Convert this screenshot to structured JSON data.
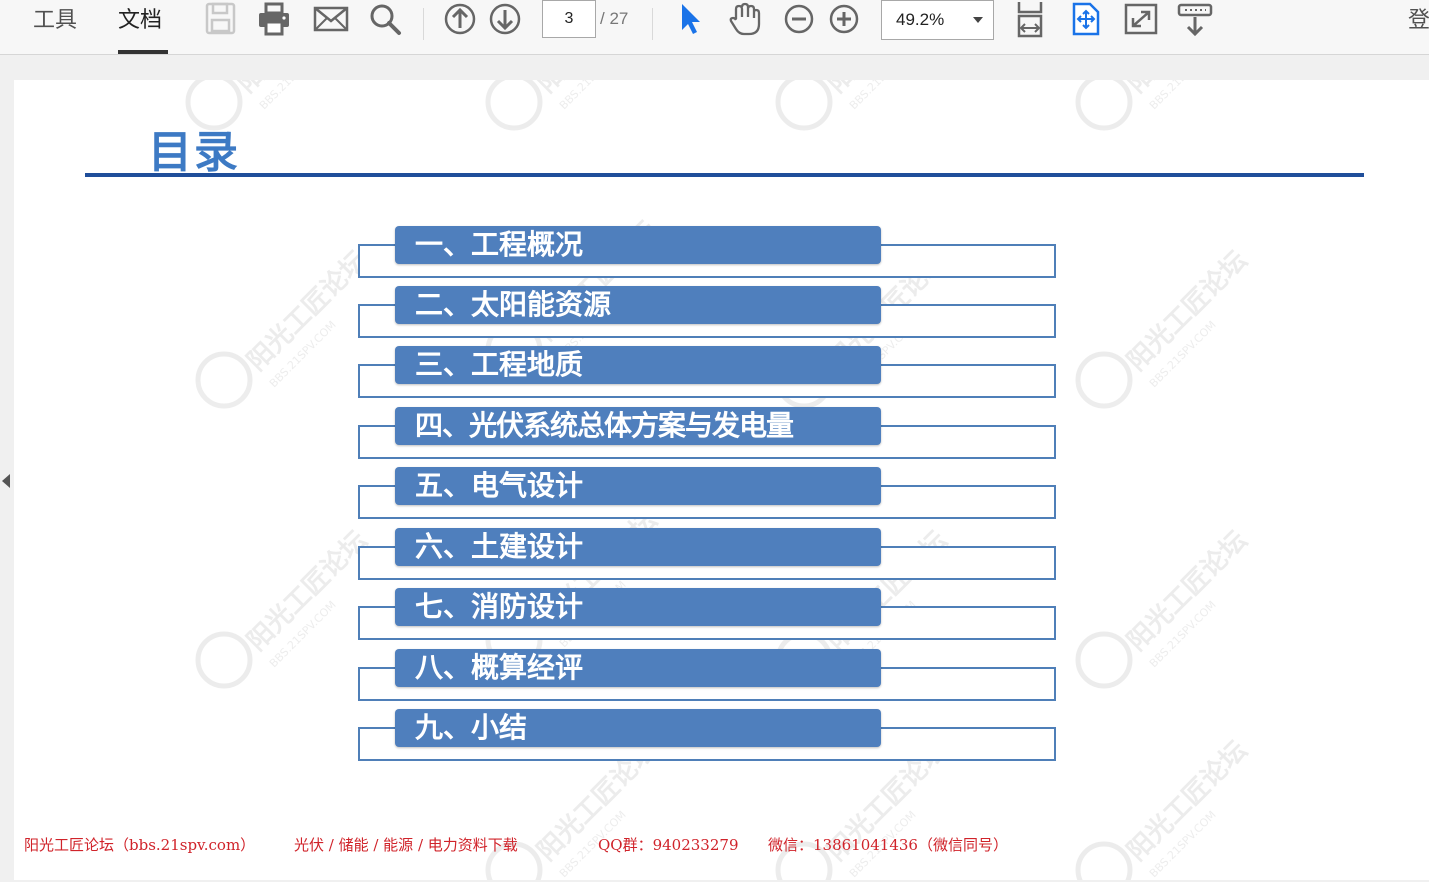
{
  "toolbar": {
    "tabs": [
      {
        "label": "工具"
      },
      {
        "label": "文档"
      }
    ],
    "active_tab": "文档",
    "page_current": "3",
    "page_total": "/ 27",
    "zoom": "49.2%",
    "login_label": "登",
    "icons": [
      "save-icon",
      "print-icon",
      "email-icon",
      "search-icon",
      "prev-page-icon",
      "next-page-icon",
      "select-cursor-icon",
      "hand-tool-icon",
      "zoom-out-icon",
      "zoom-in-icon",
      "fit-width-icon",
      "fit-page-icon",
      "fullscreen-icon",
      "read-mode-icon"
    ],
    "accent_color": "#1a73e8"
  },
  "document": {
    "title": "目录",
    "toc": [
      {
        "label": "一、工程概况"
      },
      {
        "label": "二、太阳能资源"
      },
      {
        "label": "三、工程地质"
      },
      {
        "label": "四、光伏系统总体方案与发电量"
      },
      {
        "label": "五、电气设计"
      },
      {
        "label": "六、土建设计"
      },
      {
        "label": "七、消防设计"
      },
      {
        "label": "八、概算经评"
      },
      {
        "label": "九、小结"
      }
    ],
    "footer": {
      "site": "阳光工匠论坛（bbs.21spv.com）",
      "topics": "光伏 / 储能 / 能源 / 电力资料下载",
      "qq": "QQ群：940233279",
      "wechat": "微信：13861041436（微信同号）"
    },
    "watermark_text": "阳光工匠论坛",
    "watermark_sub": "BBS.21SPV.COM",
    "colors": {
      "title": "#3d7ac4",
      "rule": "#1f4e9a",
      "toc_fill": "#4f7fbd",
      "toc_frame": "#4f7fb8",
      "footer": "#d0232a"
    }
  }
}
